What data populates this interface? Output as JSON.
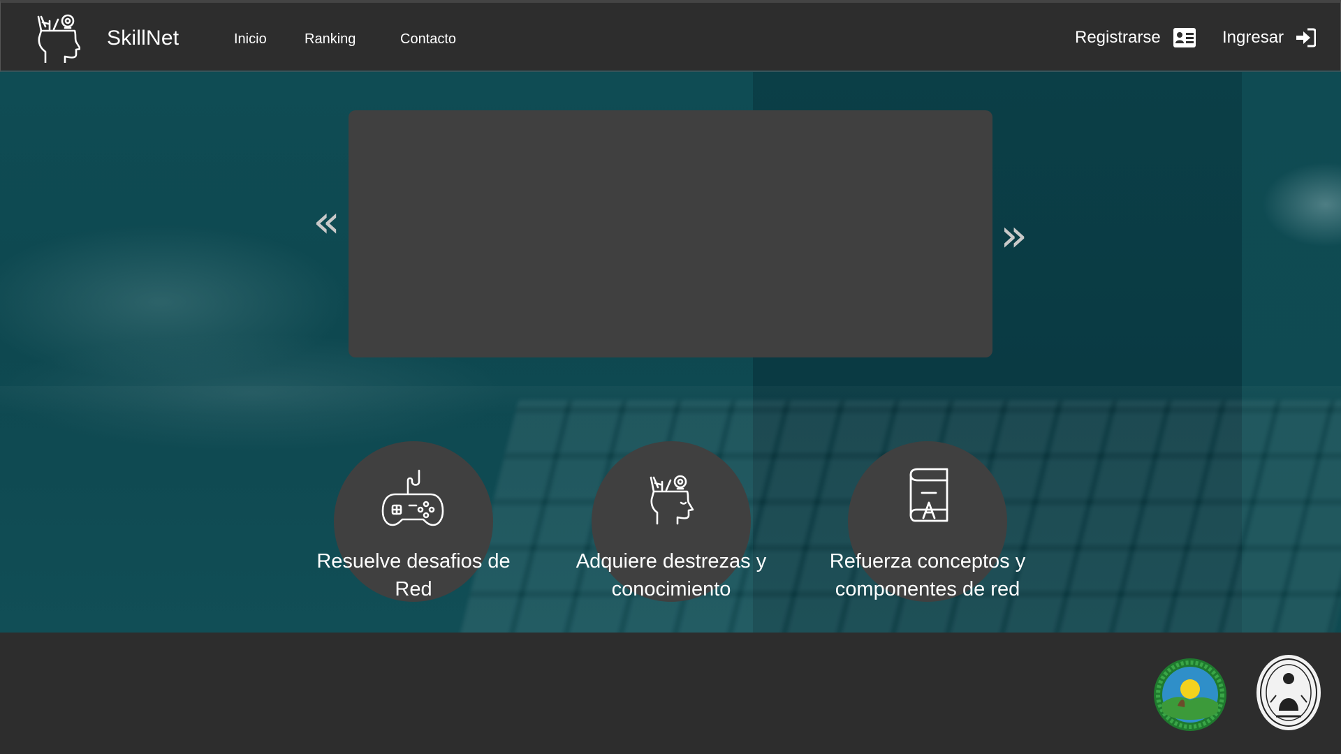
{
  "brand": {
    "name": "SkillNet",
    "logo_icon": "head-ideas-icon"
  },
  "nav": {
    "links": [
      {
        "label": "Inicio"
      },
      {
        "label": "Ranking"
      },
      {
        "label": "Contacto"
      }
    ],
    "register": {
      "label": "Registrarse",
      "icon": "id-card-icon"
    },
    "login": {
      "label": "Ingresar",
      "icon": "sign-in-icon"
    }
  },
  "carousel": {
    "prev_symbol": "«",
    "next_symbol": "»"
  },
  "features": [
    {
      "label": "Resuelve desafios de Red",
      "icon": "gamepad-icon"
    },
    {
      "label": "Adquiere destrezas y conocimiento",
      "icon": "head-ideas-icon"
    },
    {
      "label": "Refuerza conceptos y componentes de red",
      "icon": "book-icon"
    }
  ],
  "footer": {
    "seals": [
      "green-seal-logo",
      "university-seal-logo"
    ]
  },
  "colors": {
    "navbar": "#2d2d2d",
    "hero_teal": "#0f4c54",
    "card_gray": "#404040",
    "footer": "#2d2d2d"
  }
}
